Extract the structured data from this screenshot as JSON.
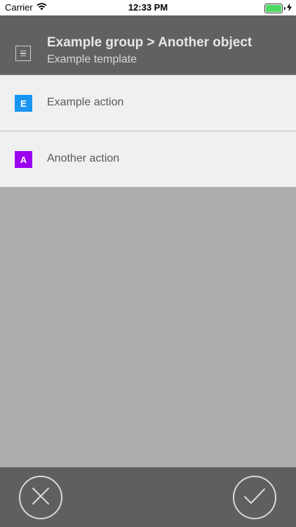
{
  "status_bar": {
    "carrier": "Carrier",
    "time": "12:33 PM"
  },
  "header": {
    "title": "Example group > Another object",
    "subtitle": "Example template",
    "icon": "template-icon"
  },
  "actions": [
    {
      "letter": "E",
      "label": "Example action",
      "color": "#1a96f0"
    },
    {
      "letter": "A",
      "label": "Another action",
      "color": "#9b00f0"
    }
  ],
  "bottom_bar": {
    "cancel_icon": "close-icon",
    "confirm_icon": "checkmark-icon"
  },
  "colors": {
    "header_bg": "#616161",
    "content_bg": "#adadad",
    "row_bg": "#f0f0f0",
    "bottom_bg": "#5f5f5f"
  }
}
